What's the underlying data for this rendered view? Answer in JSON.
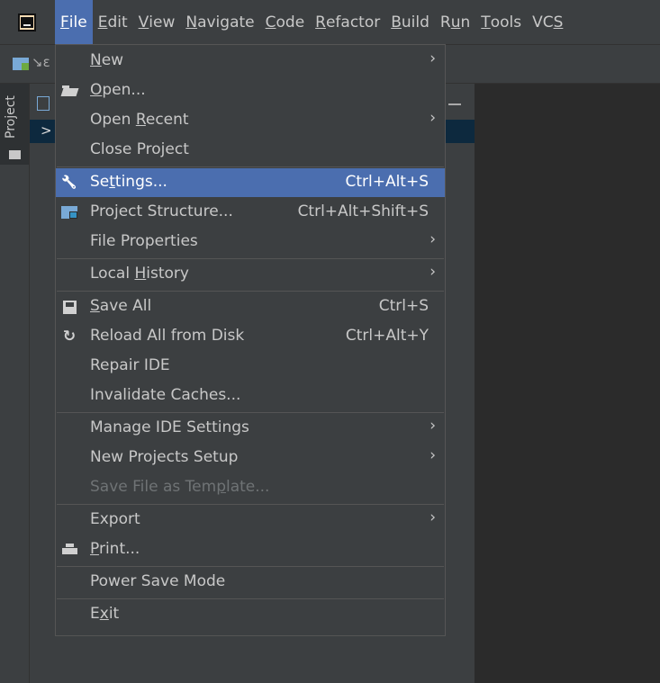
{
  "menubar": {
    "items": [
      {
        "label": "File",
        "mnemonic_index": 0
      },
      {
        "label": "Edit",
        "mnemonic_index": 0
      },
      {
        "label": "View",
        "mnemonic_index": 0
      },
      {
        "label": "Navigate",
        "mnemonic_index": 0
      },
      {
        "label": "Code",
        "mnemonic_index": 0
      },
      {
        "label": "Refactor",
        "mnemonic_index": 0
      },
      {
        "label": "Build",
        "mnemonic_index": 0
      },
      {
        "label": "Run",
        "mnemonic_index": 1
      },
      {
        "label": "Tools",
        "mnemonic_index": 0
      },
      {
        "label": "VCS",
        "mnemonic_index": 2
      }
    ],
    "active_item": "File"
  },
  "toolbar": {
    "path_fragment": "↘ɛ"
  },
  "side_stripe": {
    "project_tab_label": "Project"
  },
  "project_panel": {
    "expand_arrow": ">"
  },
  "file_menu": {
    "items": [
      {
        "type": "item",
        "name": "new",
        "label": "New",
        "mnemonic_index": 0,
        "submenu": true
      },
      {
        "type": "item",
        "name": "open",
        "label": "Open...",
        "mnemonic_index": 0,
        "icon": "folder-open-icon"
      },
      {
        "type": "item",
        "name": "open-recent",
        "label": "Open Recent",
        "mnemonic_index": 5,
        "submenu": true
      },
      {
        "type": "item",
        "name": "close-project",
        "label": "Close Project"
      },
      {
        "type": "separator"
      },
      {
        "type": "item",
        "name": "settings",
        "label": "Settings...",
        "mnemonic_index": 2,
        "shortcut": "Ctrl+Alt+S",
        "icon": "wrench-icon",
        "selected": true
      },
      {
        "type": "item",
        "name": "project-structure",
        "label": "Project Structure...",
        "shortcut": "Ctrl+Alt+Shift+S",
        "icon": "project-structure-icon"
      },
      {
        "type": "item",
        "name": "file-properties",
        "label": "File Properties",
        "submenu": true
      },
      {
        "type": "separator"
      },
      {
        "type": "item",
        "name": "local-history",
        "label": "Local History",
        "mnemonic_index": 6,
        "submenu": true
      },
      {
        "type": "separator"
      },
      {
        "type": "item",
        "name": "save-all",
        "label": "Save All",
        "mnemonic_index": 0,
        "shortcut": "Ctrl+S",
        "icon": "save-icon"
      },
      {
        "type": "item",
        "name": "reload-all-from-disk",
        "label": "Reload All from Disk",
        "shortcut": "Ctrl+Alt+Y",
        "icon": "reload-icon"
      },
      {
        "type": "item",
        "name": "repair-ide",
        "label": "Repair IDE"
      },
      {
        "type": "item",
        "name": "invalidate-caches",
        "label": "Invalidate Caches..."
      },
      {
        "type": "separator"
      },
      {
        "type": "item",
        "name": "manage-ide-settings",
        "label": "Manage IDE Settings",
        "submenu": true
      },
      {
        "type": "item",
        "name": "new-projects-setup",
        "label": "New Projects Setup",
        "submenu": true
      },
      {
        "type": "item",
        "name": "save-file-as-template",
        "label": "Save File as Template...",
        "mnemonic_index": 16,
        "disabled": true
      },
      {
        "type": "separator"
      },
      {
        "type": "item",
        "name": "export",
        "label": "Export",
        "submenu": true
      },
      {
        "type": "item",
        "name": "print",
        "label": "Print...",
        "mnemonic_index": 0,
        "icon": "print-icon"
      },
      {
        "type": "separator"
      },
      {
        "type": "item",
        "name": "power-save-mode",
        "label": "Power Save Mode"
      },
      {
        "type": "separator"
      },
      {
        "type": "item",
        "name": "exit",
        "label": "Exit",
        "mnemonic_index": 1
      }
    ]
  },
  "colors": {
    "selection": "#4b6eaf",
    "menu_bg": "#3c3f41",
    "editor_bg": "#2b2b2b",
    "text": "#c8c8c8",
    "disabled_text": "#6f7375"
  }
}
